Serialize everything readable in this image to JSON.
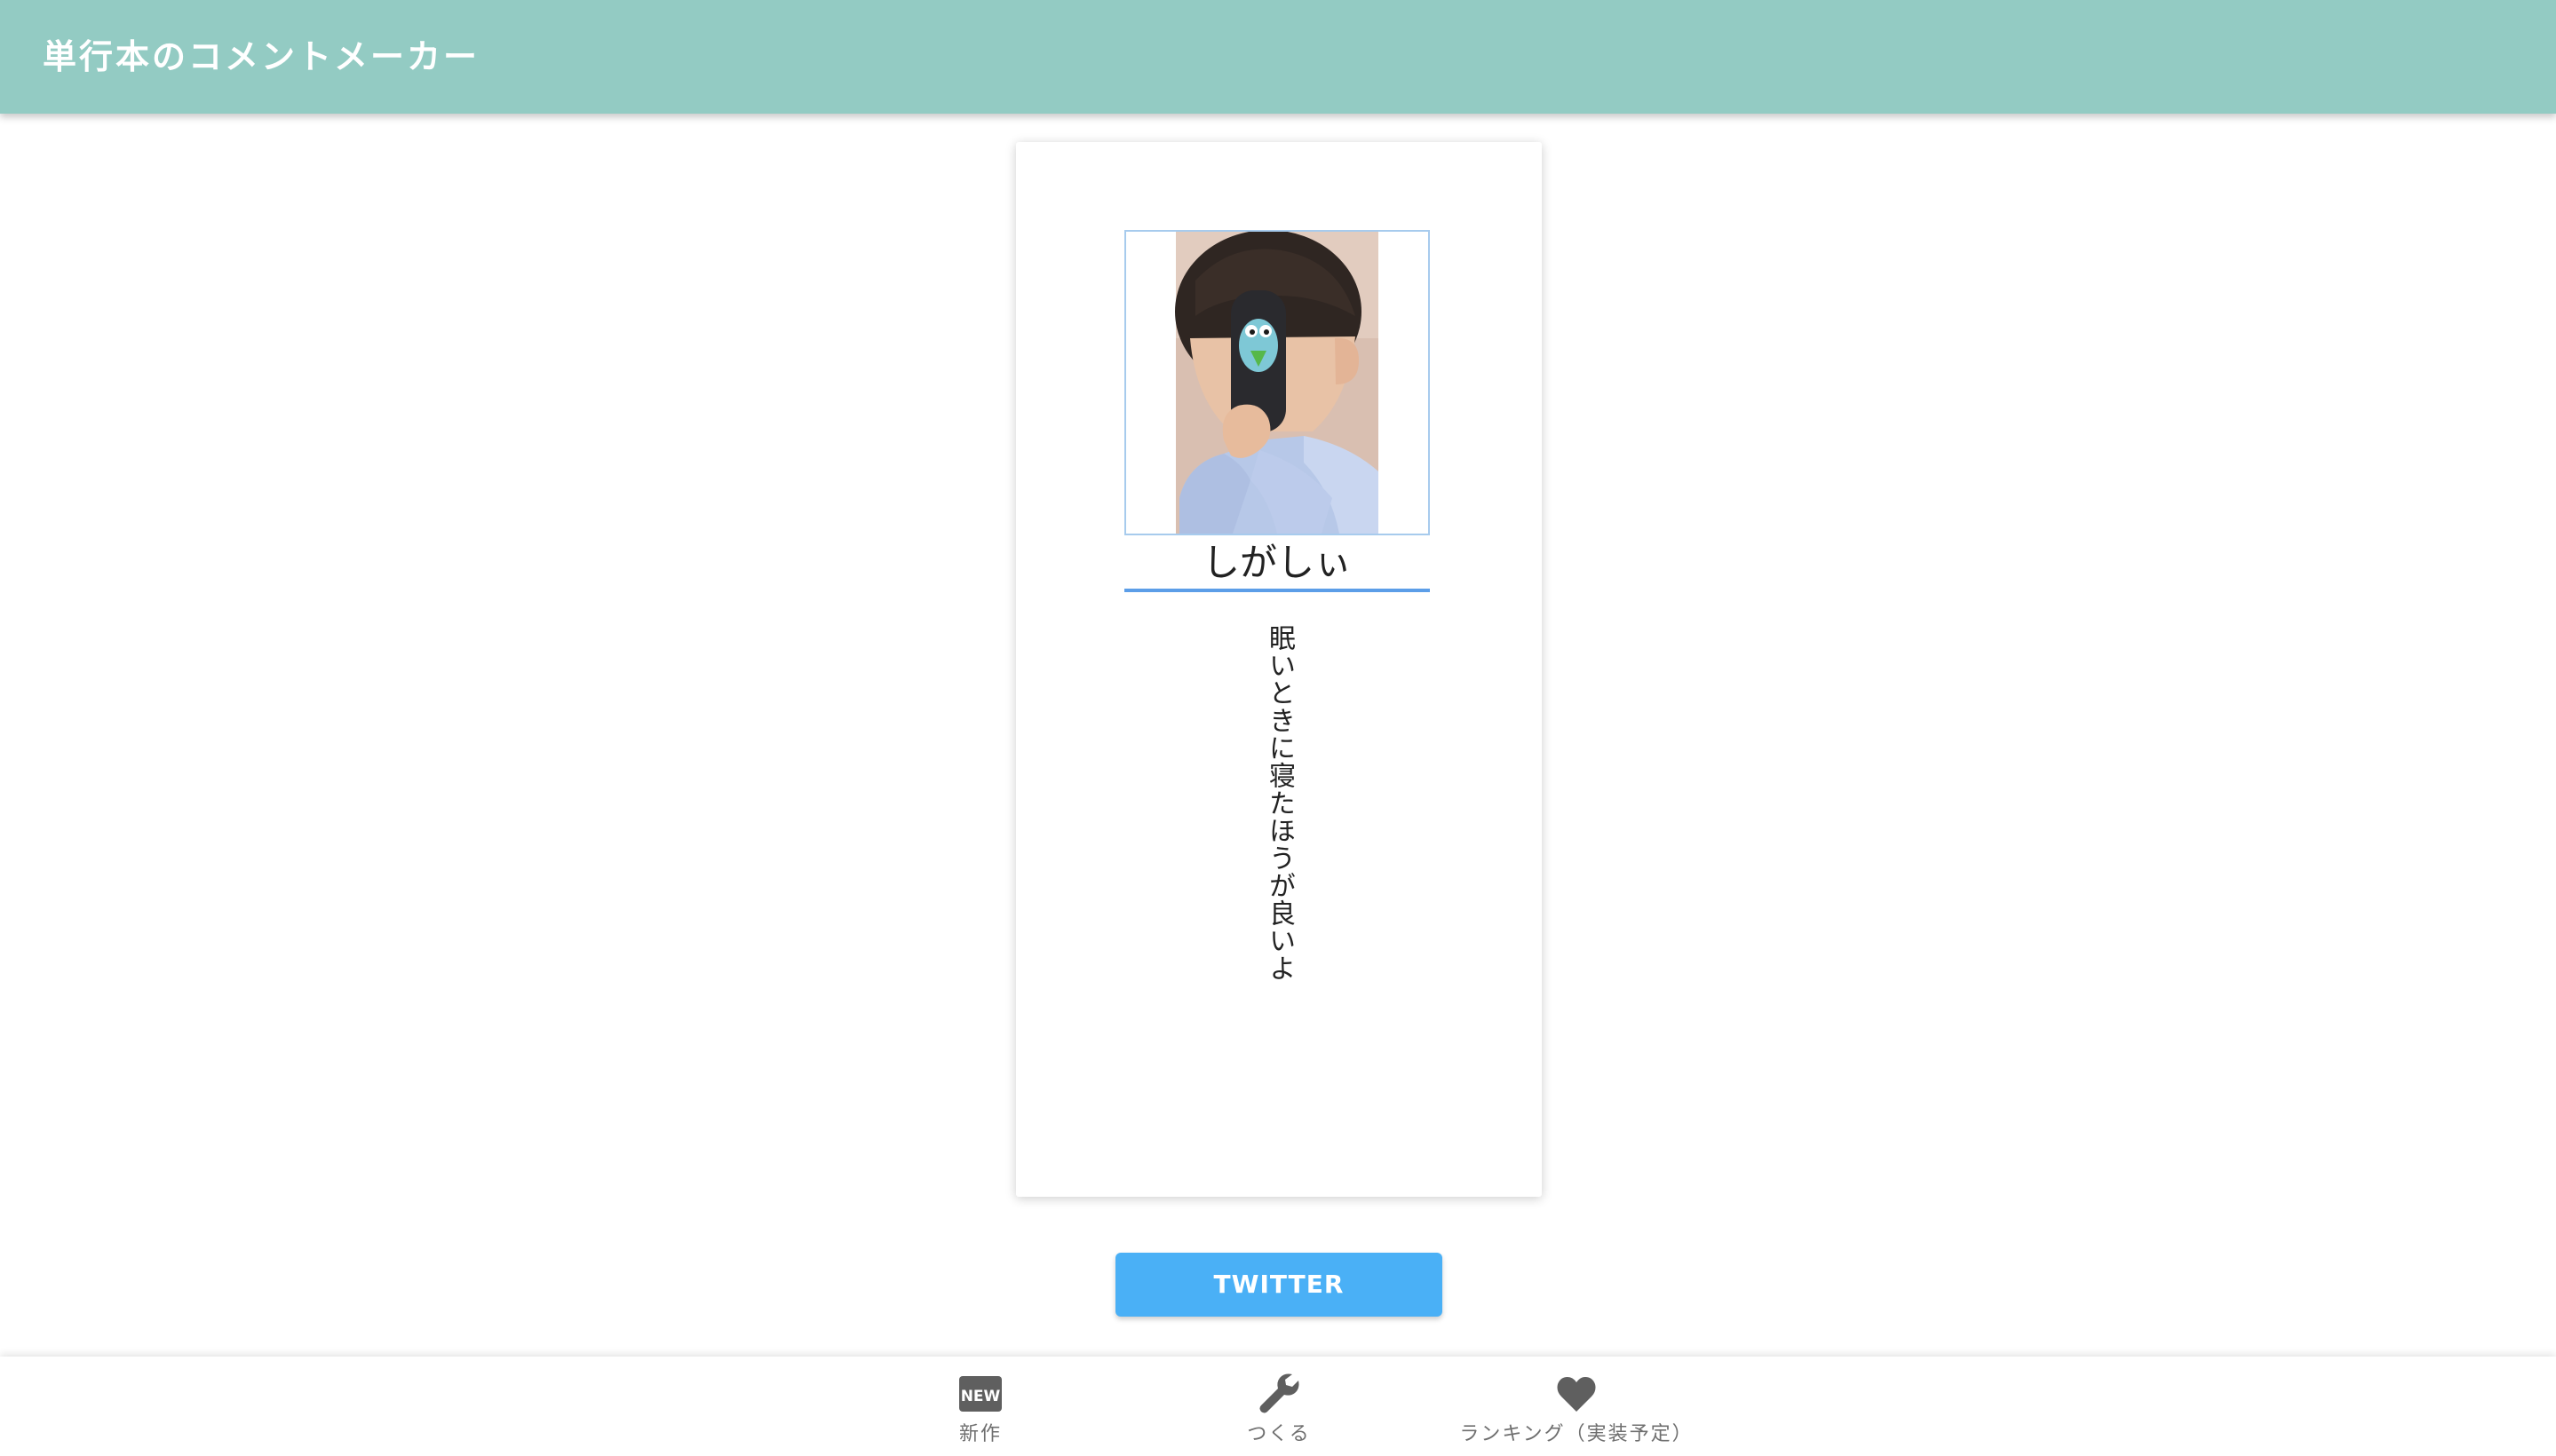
{
  "app_bar": {
    "title": "単行本のコメントメーカー",
    "background_color": "#93cbc3"
  },
  "card": {
    "photo": {
      "icon": "profile-photo"
    },
    "name": "しがしぃ",
    "comment": "眠いときに寝たほうが良いよ"
  },
  "twitter_button": {
    "label": "TWITTER",
    "color": "#4ab0f6"
  },
  "bottom_nav": {
    "items": [
      {
        "label": "新作",
        "icon": "new-badge-icon"
      },
      {
        "label": "つくる",
        "icon": "wrench-icon"
      },
      {
        "label": "ランキング（実装予定）",
        "icon": "heart-icon"
      }
    ]
  }
}
